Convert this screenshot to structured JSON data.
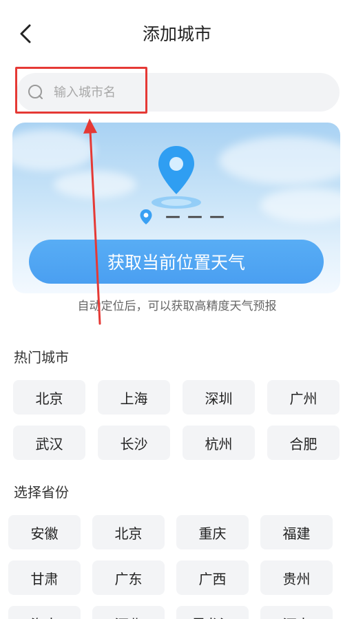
{
  "header": {
    "title": "添加城市",
    "back_icon": "chevron-left-icon"
  },
  "search": {
    "placeholder": "输入城市名",
    "value": "",
    "icon": "search-icon"
  },
  "location_card": {
    "pin_icon": "map-pin-icon",
    "location_text": "———",
    "button_label": "获取当前位置天气"
  },
  "tip": "自动定位后，可以获取高精度天气预报",
  "hot_cities": {
    "title": "热门城市",
    "items": [
      "北京",
      "上海",
      "深圳",
      "广州",
      "武汉",
      "长沙",
      "杭州",
      "合肥"
    ]
  },
  "provinces": {
    "title": "选择省份",
    "items": [
      "安徽",
      "北京",
      "重庆",
      "福建",
      "甘肃",
      "广东",
      "广西",
      "贵州",
      "海南",
      "河北",
      "黑龙江",
      "河南"
    ]
  },
  "colors": {
    "accent": "#4a9ff1",
    "annotation": "#e53935",
    "chip_bg": "#f3f4f6"
  }
}
